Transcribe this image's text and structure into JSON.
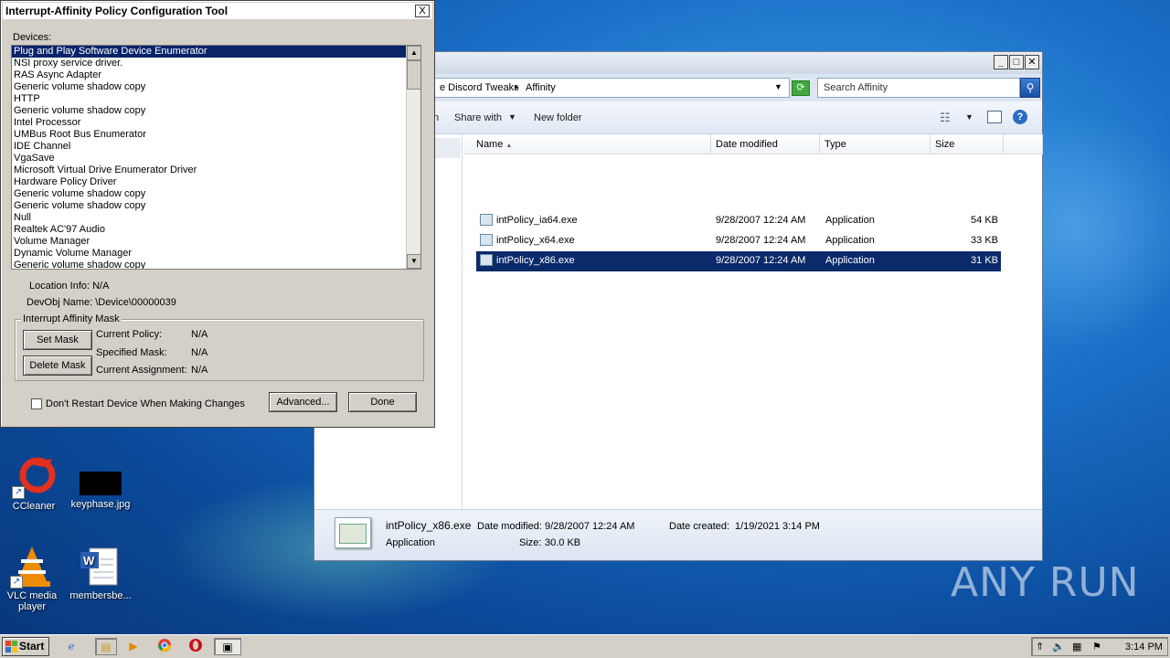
{
  "desktop": {
    "icons": [
      {
        "label": "CCleaner",
        "icon": "ccleaner-icon"
      },
      {
        "label": "keyphase.jpg",
        "icon": "image-file-icon"
      },
      {
        "label": "VLC media player",
        "icon": "vlc-cone-icon"
      },
      {
        "label": "membersbe...",
        "icon": "word-document-icon"
      }
    ],
    "watermark": "ANY  RUN"
  },
  "explorer": {
    "breadcrumb": [
      "e Discord Tweaks",
      "Affinity"
    ],
    "search_placeholder": "Search Affinity",
    "toolbar": {
      "organize_partial": "n",
      "share_with": "Share with",
      "new_folder": "New folder"
    },
    "columns": [
      "Name",
      "Date modified",
      "Type",
      "Size"
    ],
    "files": [
      {
        "name": "intPolicy_ia64.exe",
        "date": "9/28/2007 12:24 AM",
        "type": "Application",
        "size": "54 KB",
        "selected": false
      },
      {
        "name": "intPolicy_x64.exe",
        "date": "9/28/2007 12:24 AM",
        "type": "Application",
        "size": "33 KB",
        "selected": false
      },
      {
        "name": "intPolicy_x86.exe",
        "date": "9/28/2007 12:24 AM",
        "type": "Application",
        "size": "31 KB",
        "selected": true
      }
    ],
    "details": {
      "filename": "intPolicy_x86.exe",
      "date_modified_label": "Date modified:",
      "date_modified": "9/28/2007 12:24 AM",
      "date_created_label": "Date created:",
      "date_created": "1/19/2021 3:14 PM",
      "type": "Application",
      "size_label": "Size:",
      "size": "30.0 KB"
    }
  },
  "dialog": {
    "title": "Interrupt-Affinity Policy Configuration Tool",
    "devices_label": "Devices:",
    "devices": [
      "Plug and Play Software Device Enumerator",
      "NSI proxy service driver.",
      "RAS Async Adapter",
      "Generic volume shadow copy",
      "HTTP",
      "Generic volume shadow copy",
      "Intel Processor",
      "UMBus Root Bus Enumerator",
      "IDE Channel",
      "VgaSave",
      "Microsoft Virtual Drive Enumerator Driver",
      "Hardware Policy Driver",
      "Generic volume shadow copy",
      "Generic volume shadow copy",
      "Null",
      "Realtek AC'97 Audio",
      "Volume Manager",
      "Dynamic Volume Manager",
      "Generic volume shadow copy"
    ],
    "location_info": "Location Info: N/A",
    "devobj_name": "DevObj Name: \\Device\\00000039",
    "group_label": "Interrupt Affinity Mask",
    "set_mask": "Set Mask",
    "delete_mask": "Delete Mask",
    "current_policy_label": "Current Policy:",
    "current_policy": "N/A",
    "specified_mask_label": "Specified Mask:",
    "specified_mask": "N/A",
    "current_assignment_label": "Current Assignment:",
    "current_assignment": "N/A",
    "dont_restart_label": "Don't Restart Device When Making Changes",
    "advanced": "Advanced...",
    "done": "Done",
    "close": "X"
  },
  "taskbar": {
    "start": "Start",
    "clock": "3:14 PM"
  }
}
